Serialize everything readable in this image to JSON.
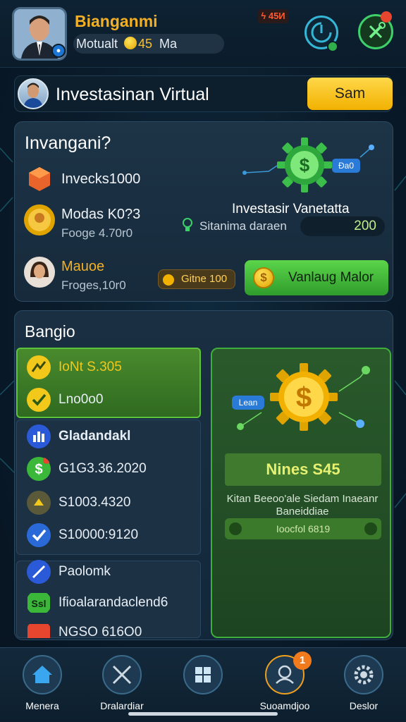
{
  "header": {
    "user_name": "Bianganmi",
    "balance_label": "Motualt",
    "balance_value": "45",
    "balance_unit": "Ma",
    "top_badge": "ϟ 45И"
  },
  "banner": {
    "title": "Investasinan Virtual",
    "button_label": "Sam"
  },
  "card1": {
    "title": "Invangani?",
    "items": [
      {
        "line1": "Invecks1000",
        "line2": ""
      },
      {
        "line1": "Modas K0?3",
        "line2": "Fooge 4.70r0"
      },
      {
        "line1": "Mauoe",
        "line2": "Froges,10r0"
      }
    ],
    "tag": "Ða0",
    "subtitle": "Investasir Vanetatta",
    "status_label": "Sitanima daraen",
    "status_value": "200",
    "pill_label": "Gitne 100",
    "green_button": "Vanlaug Malor"
  },
  "card2": {
    "title": "Bangio",
    "left_items": [
      {
        "label": "IoNt S.305",
        "color": "#f2c81a"
      },
      {
        "label": "Lno0o0",
        "color": "#e8eef5"
      },
      {
        "label": "Gladandakl",
        "color": "#ffffff"
      },
      {
        "label": "G1G3.36.2020",
        "color": "#e8eef5"
      },
      {
        "label": "S1003.4320",
        "color": "#e8eef5"
      },
      {
        "label": "S10000:9120",
        "color": "#e8eef5"
      },
      {
        "label": "Paolomk",
        "color": "#e8eef5"
      },
      {
        "label": "Ifioalarandaclend6",
        "color": "#e8eef5"
      },
      {
        "label": "NGSO 616O0",
        "color": "#e8eef5"
      }
    ],
    "right_tag": "Lean",
    "right_title": "Nines S45",
    "right_desc": "Kitan Beeoo'ale Siedam Inaeanr Baneiddiae",
    "right_pill": "Ioocfol 6819"
  },
  "nav": {
    "items": [
      "Menera",
      "Dralardiar",
      "",
      "Suoamdjoo",
      "Deslor"
    ],
    "badge": "1"
  }
}
